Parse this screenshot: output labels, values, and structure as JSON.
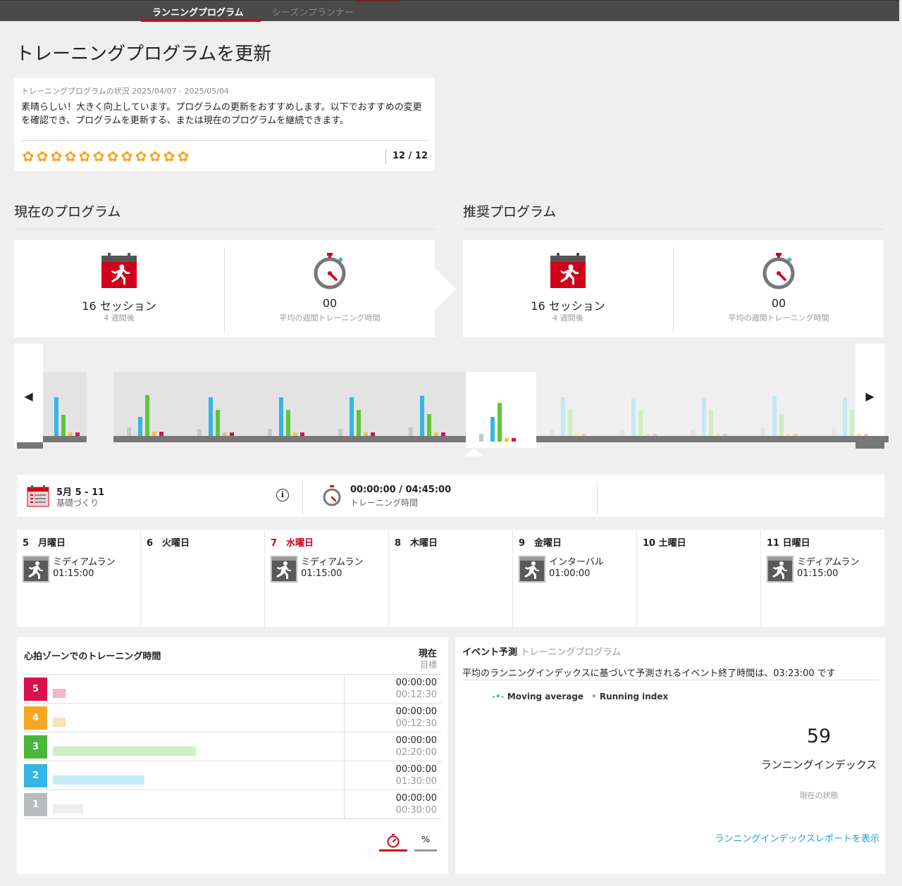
{
  "nav": {
    "tabs": [
      {
        "label": "ランニングプログラム",
        "active": true
      },
      {
        "label": "シーズンプランナー",
        "active": false
      }
    ]
  },
  "page_title": "トレーニングプログラムを更新",
  "status": {
    "subtitle": "トレーニングプログラムの状況 2025/04/07 - 2025/05/04",
    "message": "素晴らしい！大きく向上しています。プログラムの更新をおすすめします。以下でおすすめの変更を確認でき、プログラムを更新する、または現在のプログラムを継続できます。",
    "stars_filled": 12,
    "stars_total": 12,
    "count": "12 / 12"
  },
  "current_program": {
    "title": "現在のプログラム",
    "sessions": "16 セッション",
    "sessions_sub": "4 週間後",
    "avg_time": "00",
    "avg_time_sub": "平均の週間トレーニング時間"
  },
  "recommended_program": {
    "title": "推奨プログラム",
    "sessions": "16 セッション",
    "sessions_sub": "4 週間後",
    "avg_time": "00",
    "avg_time_sub": "平均の週間トレーニング時間"
  },
  "week_nav": {
    "prev": "◀",
    "next": "▶"
  },
  "weeks": [
    {
      "state": "past",
      "bars": [
        0,
        0.55,
        0.3,
        0.05,
        0.05
      ]
    },
    {
      "state": "past",
      "bars": [
        0.12,
        0.27,
        0.58,
        0.06,
        0.06
      ]
    },
    {
      "state": "past",
      "bars": [
        0.1,
        0.55,
        0.37,
        0.05,
        0.05
      ]
    },
    {
      "state": "past",
      "bars": [
        0.1,
        0.55,
        0.37,
        0.05,
        0.05
      ]
    },
    {
      "state": "past",
      "bars": [
        0.1,
        0.55,
        0.37,
        0.05,
        0.05
      ]
    },
    {
      "state": "past",
      "bars": [
        0.12,
        0.57,
        0.31,
        0.05,
        0.05
      ]
    },
    {
      "state": "current",
      "bars": [
        0.11,
        0.35,
        0.55,
        0.05,
        0.05
      ]
    },
    {
      "state": "future",
      "bars": [
        0.09,
        0.55,
        0.37,
        0.03,
        0.03
      ]
    },
    {
      "state": "future",
      "bars": [
        0.09,
        0.55,
        0.37,
        0.03,
        0.03
      ]
    },
    {
      "state": "future",
      "bars": [
        0.09,
        0.55,
        0.37,
        0.03,
        0.03
      ]
    },
    {
      "state": "future",
      "bars": [
        0.12,
        0.57,
        0.31,
        0.03,
        0.03
      ]
    },
    {
      "state": "future",
      "bars": [
        0.12,
        0.55,
        0.37,
        0.03,
        0.03
      ]
    }
  ],
  "week_info": {
    "dates": "5月 5 - 11",
    "phase": "基礎づくり",
    "info": "i",
    "time": "00:00:00 / 04:45:00",
    "time_label": "トレーニング時間"
  },
  "days": [
    {
      "label": "5　月曜日",
      "today": false,
      "session": {
        "name": "ミディアムラン",
        "time": "01:15:00"
      }
    },
    {
      "label": "6　火曜日",
      "today": false,
      "session": null
    },
    {
      "label": "7　水曜日",
      "today": true,
      "session": {
        "name": "ミディアムラン",
        "time": "01:15:00"
      }
    },
    {
      "label": "8　木曜日",
      "today": false,
      "session": null
    },
    {
      "label": "9　金曜日",
      "today": false,
      "session": {
        "name": "インターバル",
        "time": "01:00:00"
      }
    },
    {
      "label": "10 土曜日",
      "today": false,
      "session": null
    },
    {
      "label": "11 日曜日",
      "today": false,
      "session": {
        "name": "ミディアムラン",
        "time": "01:15:00"
      }
    }
  ],
  "hr_zones": {
    "title": "心拍ゾーンでのトレーニング時間",
    "current_label": "現在",
    "target_label": "目標",
    "zones": [
      {
        "zone": "5",
        "color": "#d8104e",
        "bar_color": "#f3b6c8",
        "fraction": 0.0446,
        "current": "00:00:00",
        "target": "00:12:30"
      },
      {
        "zone": "4",
        "color": "#f5a623",
        "bar_color": "#fbe2b3",
        "fraction": 0.0446,
        "current": "00:00:00",
        "target": "00:12:30"
      },
      {
        "zone": "3",
        "color": "#49b83a",
        "bar_color": "#cfefc6",
        "fraction": 0.5,
        "current": "00:00:00",
        "target": "02:20:00"
      },
      {
        "zone": "2",
        "color": "#35b6e5",
        "bar_color": "#c7ebf8",
        "fraction": 0.3214,
        "current": "00:00:00",
        "target": "01:30:00"
      },
      {
        "zone": "1",
        "color": "#b8bcbd",
        "bar_color": "#eceeee",
        "fraction": 0.1071,
        "current": "00:00:00",
        "target": "00:30:00"
      }
    ],
    "toggle_time": "stopwatch-icon",
    "toggle_percent": "%"
  },
  "event": {
    "title": "イベント予測",
    "title_sub": "トレーニングプログラム",
    "message": "平均のランニングインデックスに基づいて予測されるイベント終了時間は、03:23:00 です",
    "legend": [
      {
        "label": "Moving average",
        "color": "#35b6e5"
      },
      {
        "label": "Running index",
        "color": "#999999"
      }
    ],
    "running_index": "59",
    "running_index_label": "ランニングインデックス",
    "running_index_sub": "現在の状態",
    "link": "ランニングインデックスレポートを表示"
  }
}
